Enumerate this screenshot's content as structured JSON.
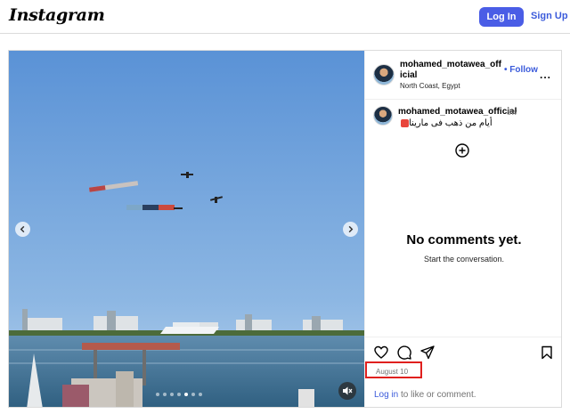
{
  "header": {
    "logo": "Instagram",
    "login_label": "Log In",
    "signup_label": "Sign Up"
  },
  "post": {
    "username": "mohamed_motawea_official",
    "follow_label": "• Follow",
    "location": "North Coast, Egypt",
    "more_label": "...",
    "caption": {
      "username": "mohamed_motawea_official",
      "time": "8w",
      "text": "أيام من ذهب فى مارينا"
    },
    "empty_title": "No comments yet.",
    "empty_subtitle": "Start the conversation.",
    "date": "August 10",
    "login_link": "Log in",
    "login_suffix": " to like or comment.",
    "carousel_slides": 7,
    "carousel_active": 4
  },
  "icons": [
    "add-comment-icon",
    "heart-icon",
    "comment-icon",
    "share-icon",
    "bookmark-icon",
    "mute-icon",
    "chevron-left-icon",
    "chevron-right-icon"
  ],
  "colors": {
    "brand_button": "#4a5de6",
    "link": "#3b5bdb",
    "highlight": "#e0201e",
    "sky": "#7aa9de",
    "sea": "#3d6f92"
  }
}
